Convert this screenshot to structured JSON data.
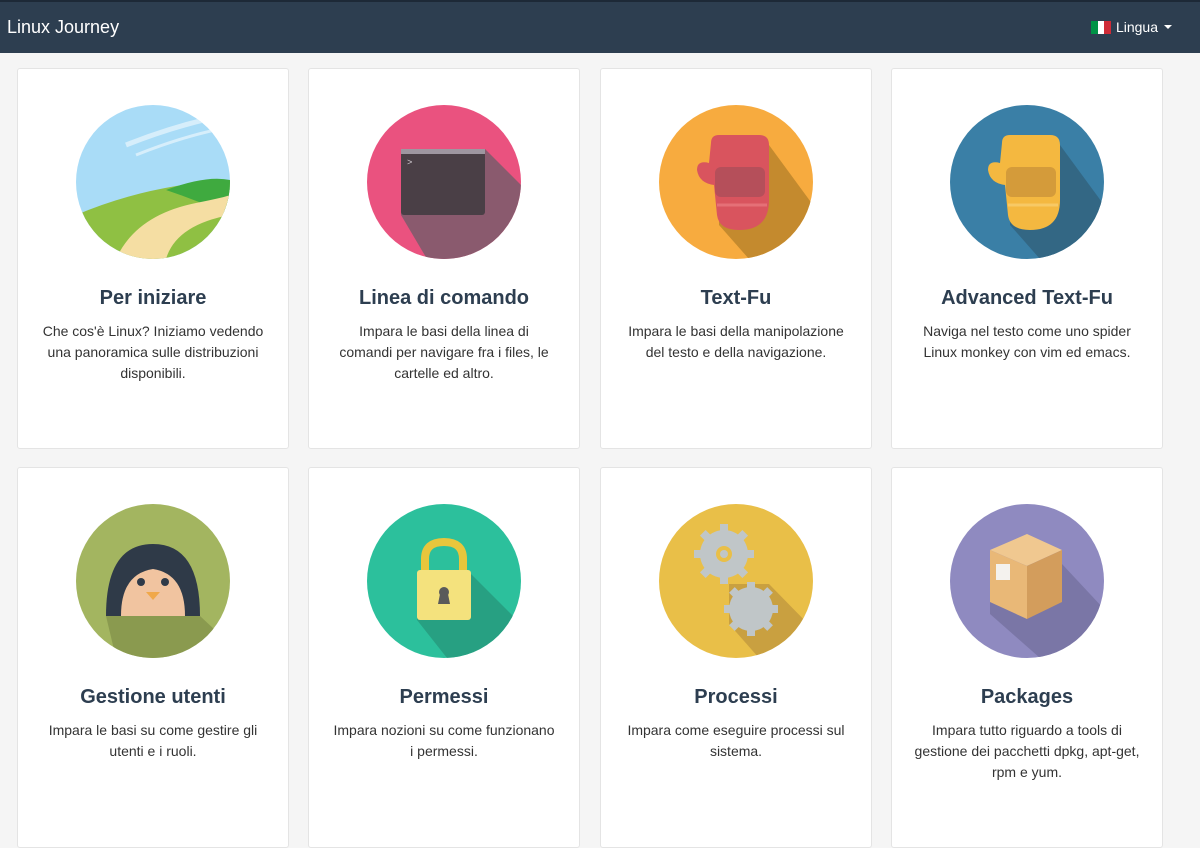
{
  "navbar": {
    "brand": "Linux Journey",
    "language_label": "Lingua",
    "flag_colors": [
      "#009246",
      "#ffffff",
      "#ce2b37"
    ]
  },
  "cards": [
    {
      "title": "Per iniziare",
      "description": "Che cos'è Linux? Iniziamo vedendo una panoramica sulle distribuzioni disponibili.",
      "icon": "landscape-icon",
      "color": "#a9dcf7"
    },
    {
      "title": "Linea di comando",
      "description": "Impara le basi della linea di comandi per navigare fra i files, le cartelle ed altro.",
      "icon": "terminal-icon",
      "color": "#ea527f"
    },
    {
      "title": "Text-Fu",
      "description": "Impara le basi della manipolazione del testo e della navigazione.",
      "icon": "red-glove-icon",
      "color": "#f7ab3f"
    },
    {
      "title": "Advanced Text-Fu",
      "description": "Naviga nel testo come uno spider Linux monkey con vim ed emacs.",
      "icon": "yellow-glove-icon",
      "color": "#3a7fa6"
    },
    {
      "title": "Gestione utenti",
      "description": "Impara le basi su come gestire gli utenti e i ruoli.",
      "icon": "penguin-icon",
      "color": "#a3b560"
    },
    {
      "title": "Permessi",
      "description": "Impara nozioni su come funzionano i permessi.",
      "icon": "padlock-icon",
      "color": "#2cc09c"
    },
    {
      "title": "Processi",
      "description": "Impara come eseguire processi sul sistema.",
      "icon": "gears-icon",
      "color": "#e9bf48"
    },
    {
      "title": "Packages",
      "description": "Impara tutto riguardo a tools di gestione dei pacchetti dpkg, apt-get, rpm e yum.",
      "icon": "box-icon",
      "color": "#8f8ac0"
    }
  ]
}
